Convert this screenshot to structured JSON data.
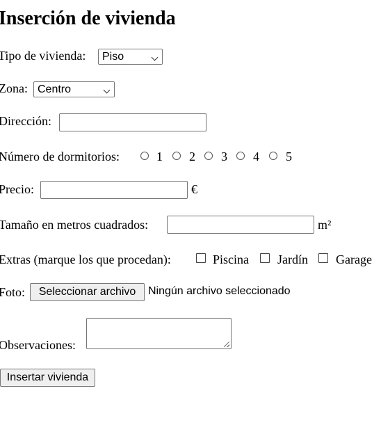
{
  "title": "Inserción de vivienda",
  "tipo": {
    "label": "Tipo de vivienda:",
    "selected": "Piso"
  },
  "zona": {
    "label": "Zona:",
    "selected": "Centro"
  },
  "direccion": {
    "label": "Dirección:",
    "value": ""
  },
  "dormitorios": {
    "label": "Número de dormitorios:",
    "options": [
      "1",
      "2",
      "3",
      "4",
      "5"
    ]
  },
  "precio": {
    "label": "Precio:",
    "value": "",
    "unit": "€"
  },
  "tamano": {
    "label": "Tamaño en metros cuadrados:",
    "value": "",
    "unit": "m²"
  },
  "extras": {
    "label": "Extras (marque los que procedan):",
    "options": [
      "Piscina",
      "Jardín",
      "Garage"
    ]
  },
  "foto": {
    "label": "Foto:",
    "button": "Seleccionar archivo",
    "status": "Ningún archivo seleccionado"
  },
  "observaciones": {
    "label": "Observaciones:",
    "value": ""
  },
  "submit": {
    "label": "Insertar vivienda"
  }
}
